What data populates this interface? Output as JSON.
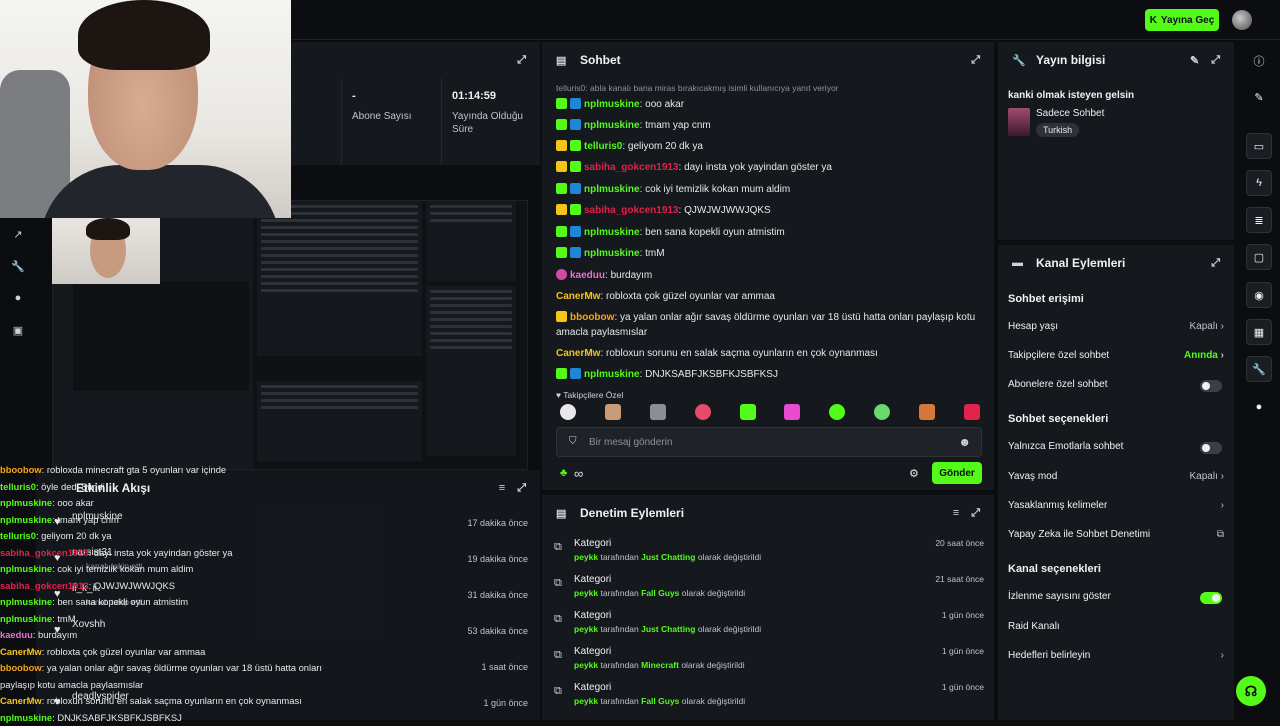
{
  "topbar": {
    "go_live_label": "Yayına Geç",
    "go_live_icon": "kick-logo-icon"
  },
  "stats": [
    {
      "value": "-",
      "label": "Abone Sayısı"
    },
    {
      "value": "01:14:59",
      "label": "Yayında Olduğu Süre"
    }
  ],
  "chat": {
    "title": "Sohbet",
    "replying": "telluris0: abla kanalı bana miras bırakıcakmış isimli kullanıcıya yanıt veriyor",
    "messages": [
      {
        "user": "nplmuskine",
        "color": "#53fc18",
        "badges": [
          "g",
          "b"
        ],
        "text": "ooo akar"
      },
      {
        "user": "nplmuskine",
        "color": "#53fc18",
        "badges": [
          "g",
          "b"
        ],
        "text": "tmam yap cnm"
      },
      {
        "user": "telluris0",
        "color": "#53fc18",
        "badges": [
          "y",
          "g"
        ],
        "text": "geliyom 20 dk ya"
      },
      {
        "user": "sabiha_gokcen1913",
        "color": "#e0224a",
        "badges": [
          "y",
          "g"
        ],
        "text": "dayı insta yok yayindan göster ya"
      },
      {
        "user": "nplmuskine",
        "color": "#53fc18",
        "badges": [
          "g",
          "b"
        ],
        "text": "cok iyi temizlik kokan mum aldim"
      },
      {
        "user": "sabiha_gokcen1913",
        "color": "#e0224a",
        "badges": [
          "y",
          "g"
        ],
        "text": "QJWJWJWWJQKS"
      },
      {
        "user": "nplmuskine",
        "color": "#53fc18",
        "badges": [
          "g",
          "b"
        ],
        "text": "ben sana kopekli oyun atmistim"
      },
      {
        "user": "nplmuskine",
        "color": "#53fc18",
        "badges": [
          "g",
          "b"
        ],
        "text": "tmM"
      },
      {
        "user": "kaeduu",
        "color": "#e86fd3",
        "badges": [
          "p"
        ],
        "text": "burdayım"
      },
      {
        "user": "CanerMw",
        "color": "#f5c518",
        "badges": [],
        "text": "robloxta çok güzel oyunlar var ammaa"
      },
      {
        "user": "bboobow",
        "color": "#f5a518",
        "badges": [
          "y"
        ],
        "text": "ya yalan onlar ağır savaş öldürme oyunları var 18 üstü hatta onları paylaşıp kotu amacla paylasmıslar"
      },
      {
        "user": "CanerMw",
        "color": "#f5c518",
        "badges": [],
        "text": "robloxun sorunu en salak saçma oyunların en çok oynanması"
      },
      {
        "user": "nplmuskine",
        "color": "#53fc18",
        "badges": [
          "g",
          "b"
        ],
        "text": "DNJKSABFJKSBFKJSBFKSJ"
      }
    ],
    "followers_only": "Takipçilere Özel",
    "input_placeholder": "Bir mesaj gönderin",
    "send_label": "Gönder"
  },
  "activity": {
    "title": "Etkinlik Akışı",
    "items": [
      {
        "name": "nplmuskine",
        "sub": "",
        "time": "17 dakika önce"
      },
      {
        "name": "narsist31",
        "sub": "kanalı takip etti",
        "time": "19 dakika önce"
      },
      {
        "name": "ii_k_ii",
        "sub": "kanalı takip etti",
        "time": "31 dakika önce"
      },
      {
        "name": "Xovshh",
        "sub": "",
        "time": "53 dakika önce"
      },
      {
        "name": "",
        "sub": "",
        "time": "1 saat önce"
      },
      {
        "name": "deadlyspider",
        "sub": "",
        "time": "1 gün önce"
      }
    ]
  },
  "overlay_chat": [
    {
      "user": "bboobow",
      "color": "#f5a518",
      "text": "robloxda minecraft gta 5 oyunları var içinde"
    },
    {
      "user": "telluris0",
      "color": "#53fc18",
      "text": "öyle dedi Şimdi"
    },
    {
      "user": "nplmuskine",
      "color": "#53fc18",
      "text": "ooo akar"
    },
    {
      "user": "nplmuskine",
      "color": "#53fc18",
      "text": "tmam yap cnm"
    },
    {
      "user": "telluris0",
      "color": "#53fc18",
      "text": "geliyom 20 dk ya"
    },
    {
      "user": "sabiha_gokcen1913",
      "color": "#e0224a",
      "text": "dayı insta yok yayindan göster ya"
    },
    {
      "user": "nplmuskine",
      "color": "#53fc18",
      "text": "cok iyi temizlik kokan mum aldim"
    },
    {
      "user": "sabiha_gokcen1913",
      "color": "#e0224a",
      "text": "QJWJWJWWJQKS"
    },
    {
      "user": "nplmuskine",
      "color": "#53fc18",
      "text": "ben sana kopekli oyun atmistim"
    },
    {
      "user": "nplmuskine",
      "color": "#53fc18",
      "text": "tmM"
    },
    {
      "user": "kaeduu",
      "color": "#e86fd3",
      "text": "burdayım"
    },
    {
      "user": "CanerMw",
      "color": "#f5c518",
      "text": "robloxta çok güzel oyunlar var ammaa"
    },
    {
      "user": "bboobow",
      "color": "#f5a518",
      "text": "ya yalan onlar ağır savaş öldürme oyunları var 18 üstü hatta onları"
    },
    {
      "user": "",
      "color": "#e8e8ea",
      "text": "paylaşıp kotu amacla paylasmıslar"
    },
    {
      "user": "CanerMw",
      "color": "#f5c518",
      "text": "robloxun sorunu en salak saçma oyunların en çok oynanması"
    },
    {
      "user": "nplmuskine",
      "color": "#53fc18",
      "text": "DNJKSABFJKSBFKJSBFKSJ"
    }
  ],
  "moderation": {
    "title": "Denetim Eylemleri",
    "items": [
      {
        "title": "Kategori",
        "by": "peykk",
        "mid": "tarafından",
        "value": "Just Chatting",
        "tail": "olarak değiştirildi",
        "time": "20 saat önce"
      },
      {
        "title": "Kategori",
        "by": "peykk",
        "mid": "tarafından",
        "value": "Fall Guys",
        "tail": "olarak değiştirildi",
        "time": "21 saat önce"
      },
      {
        "title": "Kategori",
        "by": "peykk",
        "mid": "tarafından",
        "value": "Just Chatting",
        "tail": "olarak değiştirildi",
        "time": "1 gün önce"
      },
      {
        "title": "Kategori",
        "by": "peykk",
        "mid": "tarafından",
        "value": "Minecraft",
        "tail": "olarak değiştirildi",
        "time": "1 gün önce"
      },
      {
        "title": "Kategori",
        "by": "peykk",
        "mid": "tarafından",
        "value": "Fall Guys",
        "tail": "olarak değiştirildi",
        "time": "1 gün önce"
      }
    ]
  },
  "stream_info": {
    "title": "Yayın bilgisi",
    "stream_title": "kanki olmak isteyen gelsin",
    "category": "Sadece Sohbet",
    "tag": "Turkish"
  },
  "channel_actions": {
    "title": "Kanal Eylemleri",
    "chat_access": "Sohbet erişimi",
    "account_age": {
      "label": "Hesap yaşı",
      "value": "Kapalı"
    },
    "followers_chat": {
      "label": "Takipçilere özel sohbet",
      "value": "Anında"
    },
    "subs_chat": {
      "label": "Abonelere özel sohbet"
    },
    "chat_options": "Sohbet seçenekleri",
    "emote_only": {
      "label": "Yalnızca Emotlarla sohbet"
    },
    "slow_mode": {
      "label": "Yavaş mod",
      "value": "Kapalı"
    },
    "banned_words": {
      "label": "Yasaklanmış kelimeler"
    },
    "ai_moderation": {
      "label": "Yapay Zeka ile Sohbet Denetimi"
    },
    "channel_options": "Kanal seçenekleri",
    "show_viewers": {
      "label": "İzlenme sayısını göster"
    },
    "raid": {
      "label": "Raid Kanalı"
    },
    "goals": {
      "label": "Hedefleri belirleyin"
    }
  }
}
